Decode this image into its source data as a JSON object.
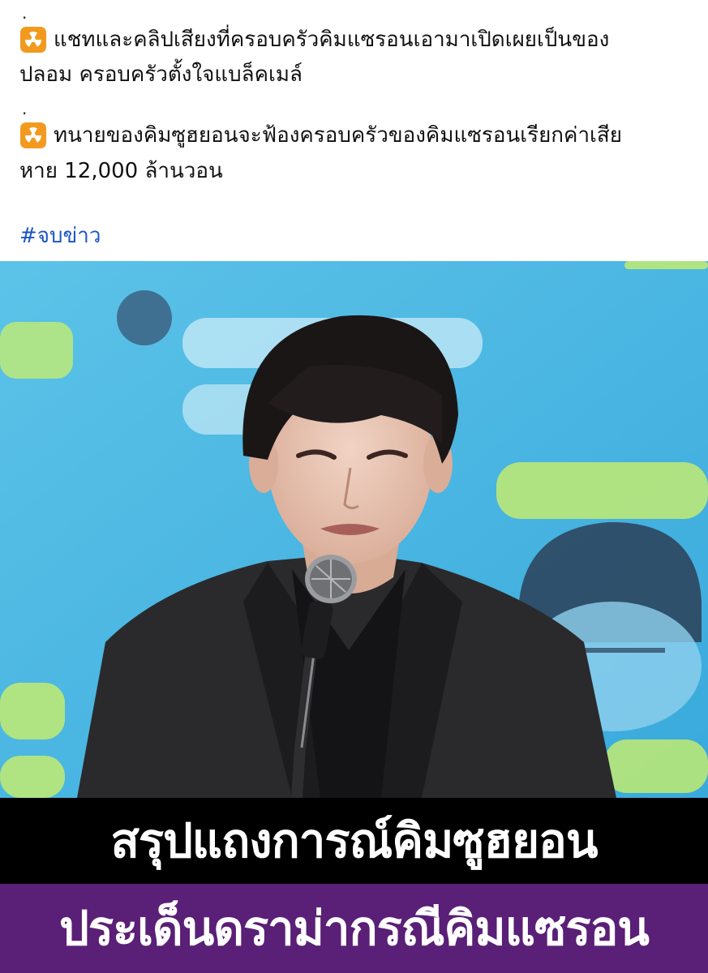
{
  "post": {
    "separators": [
      ".",
      "."
    ],
    "items": [
      {
        "icon": "radioactive-icon",
        "line1": "แชทและคลิปเสียงที่ครอบครัวคิมแซรอนเอามาเปิดเผยเป็นของ",
        "line2": "ปลอม ครอบครัวตั้งใจแบล็คเมล์"
      },
      {
        "icon": "radioactive-icon",
        "line1": "ทนายของคิมซูฮยอนจะฟ้องครอบครัวของคิมแซรอนเรียกค่าเสีย",
        "line2": "หาย 12,000 ล้านวอน"
      }
    ],
    "hashtag": "#จบข่าว"
  },
  "banner": {
    "headline": "สรุปแถงการณ์คิมซูฮยอน",
    "subheadline": "ประเด็นดราม่ากรณีคิมแซรอน"
  },
  "colors": {
    "hashtag": "#1a55c4",
    "banner_black": "#000000",
    "banner_purple": "#5a1f76",
    "photo_bg": "#4bb6e0",
    "icon_orange": "#f29a1f"
  }
}
